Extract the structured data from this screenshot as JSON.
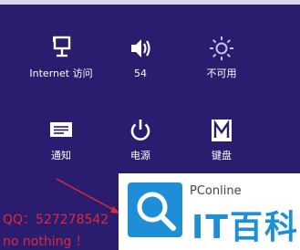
{
  "tiles": [
    {
      "label": "Internet 访问",
      "icon": "network-icon"
    },
    {
      "label": "54",
      "icon": "volume-icon"
    },
    {
      "label": "不可用",
      "icon": "brightness-icon"
    },
    {
      "label": "通知",
      "icon": "notifications-icon"
    },
    {
      "label": "电源",
      "icon": "power-icon"
    },
    {
      "label": "键盘",
      "icon": "keyboard-icon"
    }
  ],
  "watermark": {
    "qq": "QQ：527278542",
    "note": "no nothing ！",
    "color": "#e0283a"
  },
  "logo": {
    "small_text": "PConline",
    "big_text": "IT百科",
    "accent": "#1e8fd6"
  },
  "colors": {
    "background": "#2a1c6e",
    "icon": "#ffffff"
  }
}
